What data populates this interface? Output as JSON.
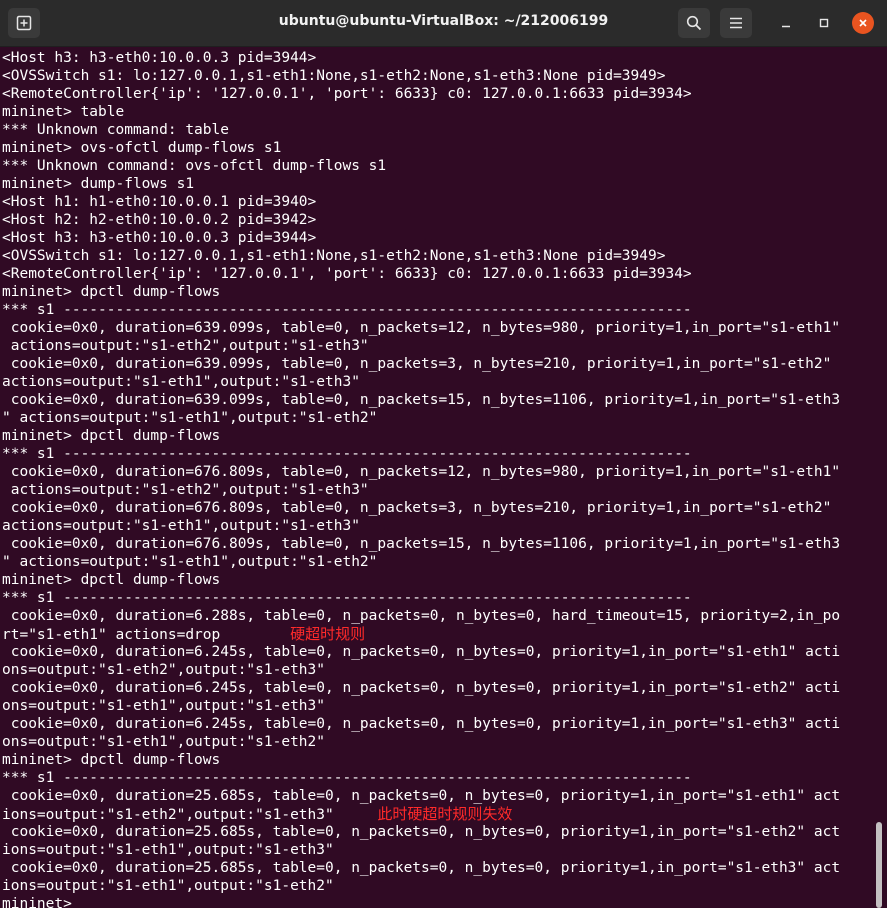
{
  "window": {
    "title": "ubuntu@ubuntu-VirtualBox: ~/212006199",
    "icons": {
      "new_tab": "new-tab-icon",
      "search": "search-icon",
      "menu": "hamburger-menu-icon",
      "minimize": "minimize-icon",
      "maximize": "maximize-icon",
      "close": "close-icon"
    },
    "accent_close": "#e95420",
    "terminal_bg": "#300a24",
    "annotation_color": "#ff2a2a"
  },
  "terminal": {
    "lines": [
      {
        "text": "<Host h3: h3-eth0:10.0.0.3 pid=3944>"
      },
      {
        "text": "<OVSSwitch s1: lo:127.0.0.1,s1-eth1:None,s1-eth2:None,s1-eth3:None pid=3949>"
      },
      {
        "text": "<RemoteController{'ip': '127.0.0.1', 'port': 6633} c0: 127.0.0.1:6633 pid=3934>"
      },
      {
        "text": "mininet> table"
      },
      {
        "text": "*** Unknown command: table"
      },
      {
        "text": "mininet> ovs-ofctl dump-flows s1"
      },
      {
        "text": "*** Unknown command: ovs-ofctl dump-flows s1"
      },
      {
        "text": "mininet> dump-flows s1"
      },
      {
        "text": "<Host h1: h1-eth0:10.0.0.1 pid=3940>"
      },
      {
        "text": "<Host h2: h2-eth0:10.0.0.2 pid=3942>"
      },
      {
        "text": "<Host h3: h3-eth0:10.0.0.3 pid=3944>"
      },
      {
        "text": "<OVSSwitch s1: lo:127.0.0.1,s1-eth1:None,s1-eth2:None,s1-eth3:None pid=3949>"
      },
      {
        "text": "<RemoteController{'ip': '127.0.0.1', 'port': 6633} c0: 127.0.0.1:6633 pid=3934>"
      },
      {
        "text": "mininet> dpctl dump-flows"
      },
      {
        "text": "*** s1 ------------------------------------------------------------------------"
      },
      {
        "text": " cookie=0x0, duration=639.099s, table=0, n_packets=12, n_bytes=980, priority=1,in_port=\"s1-eth1\""
      },
      {
        "text": " actions=output:\"s1-eth2\",output:\"s1-eth3\""
      },
      {
        "text": " cookie=0x0, duration=639.099s, table=0, n_packets=3, n_bytes=210, priority=1,in_port=\"s1-eth2\""
      },
      {
        "text": "actions=output:\"s1-eth1\",output:\"s1-eth3\""
      },
      {
        "text": " cookie=0x0, duration=639.099s, table=0, n_packets=15, n_bytes=1106, priority=1,in_port=\"s1-eth3"
      },
      {
        "text": "\" actions=output:\"s1-eth1\",output:\"s1-eth2\""
      },
      {
        "text": "mininet> dpctl dump-flows"
      },
      {
        "text": "*** s1 ------------------------------------------------------------------------"
      },
      {
        "text": " cookie=0x0, duration=676.809s, table=0, n_packets=12, n_bytes=980, priority=1,in_port=\"s1-eth1\""
      },
      {
        "text": " actions=output:\"s1-eth2\",output:\"s1-eth3\""
      },
      {
        "text": " cookie=0x0, duration=676.809s, table=0, n_packets=3, n_bytes=210, priority=1,in_port=\"s1-eth2\""
      },
      {
        "text": "actions=output:\"s1-eth1\",output:\"s1-eth3\""
      },
      {
        "text": " cookie=0x0, duration=676.809s, table=0, n_packets=15, n_bytes=1106, priority=1,in_port=\"s1-eth3"
      },
      {
        "text": "\" actions=output:\"s1-eth1\",output:\"s1-eth2\""
      },
      {
        "text": "mininet> dpctl dump-flows"
      },
      {
        "text": "*** s1 ------------------------------------------------------------------------"
      },
      {
        "text": " cookie=0x0, duration=6.288s, table=0, n_packets=0, n_bytes=0, hard_timeout=15, priority=2,in_po"
      },
      {
        "text": "rt=\"s1-eth1\" actions=drop",
        "pad": "        ",
        "annotation": "硬超时规则"
      },
      {
        "text": " cookie=0x0, duration=6.245s, table=0, n_packets=0, n_bytes=0, priority=1,in_port=\"s1-eth1\" acti"
      },
      {
        "text": "ons=output:\"s1-eth2\",output:\"s1-eth3\""
      },
      {
        "text": " cookie=0x0, duration=6.245s, table=0, n_packets=0, n_bytes=0, priority=1,in_port=\"s1-eth2\" acti"
      },
      {
        "text": "ons=output:\"s1-eth1\",output:\"s1-eth3\""
      },
      {
        "text": " cookie=0x0, duration=6.245s, table=0, n_packets=0, n_bytes=0, priority=1,in_port=\"s1-eth3\" acti"
      },
      {
        "text": "ons=output:\"s1-eth1\",output:\"s1-eth2\""
      },
      {
        "text": "mininet> dpctl dump-flows"
      },
      {
        "text": "*** s1 ------------------------------------------------------------------------"
      },
      {
        "text": " cookie=0x0, duration=25.685s, table=0, n_packets=0, n_bytes=0, priority=1,in_port=\"s1-eth1\" act"
      },
      {
        "text": "ions=output:\"s1-eth2\",output:\"s1-eth3\"",
        "pad": "     ",
        "annotation": "此时硬超时规则失效"
      },
      {
        "text": " cookie=0x0, duration=25.685s, table=0, n_packets=0, n_bytes=0, priority=1,in_port=\"s1-eth2\" act"
      },
      {
        "text": "ions=output:\"s1-eth1\",output:\"s1-eth3\""
      },
      {
        "text": " cookie=0x0, duration=25.685s, table=0, n_packets=0, n_bytes=0, priority=1,in_port=\"s1-eth3\" act"
      },
      {
        "text": "ions=output:\"s1-eth1\",output:\"s1-eth2\""
      },
      {
        "text": "mininet>"
      }
    ]
  }
}
